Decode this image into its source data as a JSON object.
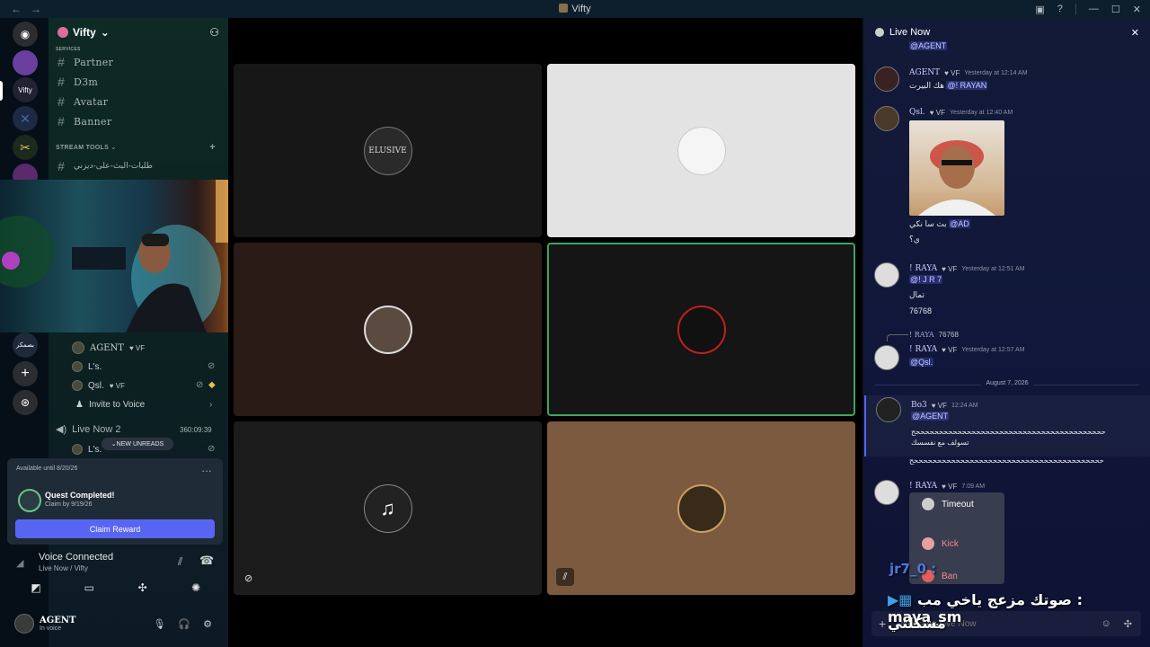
{
  "window": {
    "title": "Vifty",
    "back": "←",
    "forward": "→"
  },
  "server": {
    "name": "Vifty",
    "chevron": "⌄"
  },
  "channels": {
    "top_category": "SERVICES",
    "items": [
      {
        "label": "Partner"
      },
      {
        "label": "D3m"
      },
      {
        "label": "Avatar"
      },
      {
        "label": "Banner"
      }
    ],
    "stream_category": "STREAM TOOLS",
    "stream_channel": "طلبات-البث-على-ديزني",
    "side_label": "بصمكر"
  },
  "voice_list": {
    "users": [
      {
        "name": "AGENT",
        "badge": "VF"
      },
      {
        "name": "L's."
      },
      {
        "name": "Qsl.",
        "badge": "VF"
      }
    ],
    "invite": "Invite to Voice",
    "live2": {
      "name": "Live Now 2",
      "timer": "360:09:39"
    },
    "live2_user": "L's.",
    "new_unreads": "NEW UNREADS"
  },
  "quest": {
    "available": "Available until 8/20/26",
    "title": "Quest Completed!",
    "sub": "Claim by 9/19/26",
    "claim": "Claim Reward"
  },
  "voice_connected": {
    "title": "Voice Connected",
    "sub": "Live Now / Vifty"
  },
  "user": {
    "name": "AGENT",
    "status": "In voice"
  },
  "chat": {
    "title": "Live Now",
    "close": "✕",
    "top_mention": "@AGENT",
    "messages": [
      {
        "name": "AGENT",
        "badge": "VF",
        "time": "Yesterday at 12:14 AM",
        "text": "هك البيرت",
        "mention": "@! RAYAN"
      },
      {
        "name": "Qsl.",
        "badge": "VF",
        "time": "Yesterday at 12:40 AM",
        "line1_mention": "@AD",
        "line1": "بث سا نكي",
        "line2": "ي؟"
      },
      {
        "name": "! RAYA",
        "badge": "VF",
        "time": "Yesterday at 12:51 AM",
        "mention": "@! J R 7",
        "line1": "تمال",
        "line2": "76768"
      },
      {
        "reply_name": "! RAYA",
        "reply_text": "76768",
        "name": "! RAYA",
        "badge": "VF",
        "time": "Yesterday at 12:57 AM",
        "mention": "@Qsl."
      },
      {
        "name": "Bo3",
        "badge": "VF",
        "time": "12:24 AM",
        "mention": "@AGENT",
        "line1": "ح‏ححححححححححححححححححححححححححححححححححححححححح",
        "line2": "تسولف مع نفسسك",
        "line3": "حححححححححححححححححححححححححححححححححححححححححح"
      },
      {
        "name": "! RAYA",
        "badge": "VF",
        "time": "7:09 AM"
      }
    ],
    "date_divider": "August 7, 2026",
    "context_menu": [
      "Timeout",
      "Kick",
      "Ban"
    ],
    "input_placeholder": "Message Live Now"
  },
  "overlay": {
    "jr": "jr7_0 :",
    "line1": "صوتك مزعج ياخي مب : maya_sm",
    "line2": "مشكلتي"
  }
}
